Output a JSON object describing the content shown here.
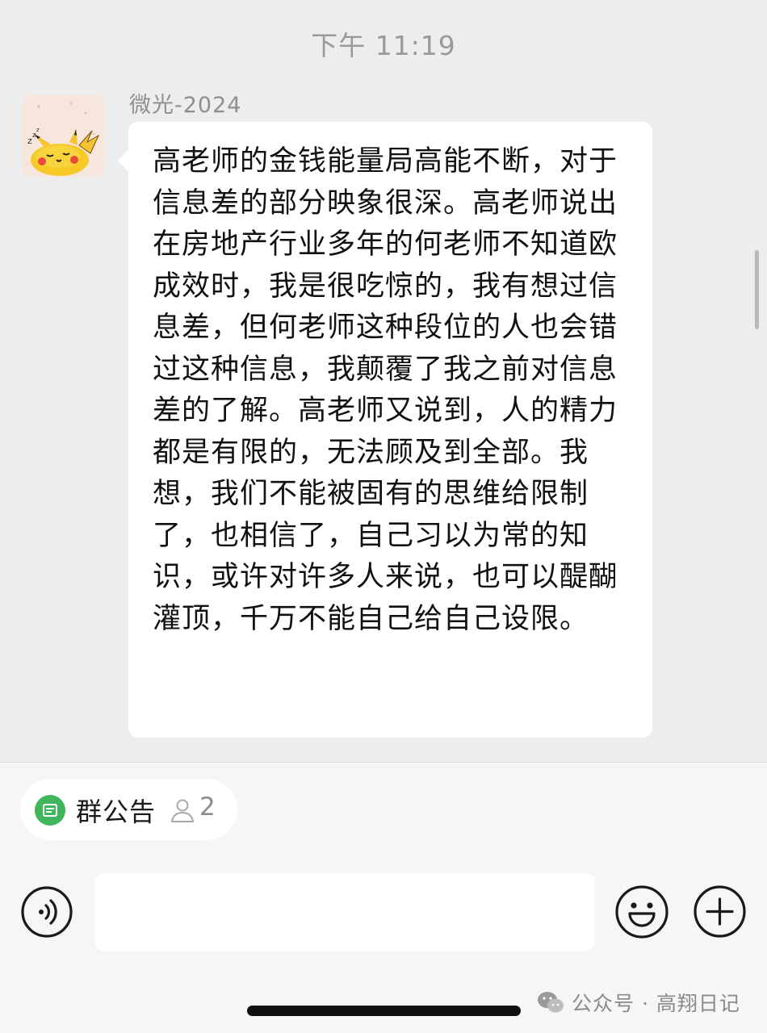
{
  "status": {
    "timestamp": "下午 11:19"
  },
  "message": {
    "sender": "微光-2024",
    "avatar_icon": "sleeping-pikachu-avatar",
    "text": "高老师的金钱能量局高能不断，对于信息差的部分映象很深。高老师说出在房地产行业多年的何老师不知道欧成效时，我是很吃惊的，我有想过信息差，但何老师这种段位的人也会错过这种信息，我颠覆了我之前对信息差的了解。高老师又说到，人的精力都是有限的，无法顾及到全部。我想，我们不能被固有的思维给限制了，也相信了，自己习以为常的知识，或许对许多人来说，也可以醍醐灌顶，千万不能自己给自己设限。"
  },
  "notice_bar": {
    "label": "群公告",
    "count": "2",
    "icon": "announcement-icon",
    "accent_color": "#3fb55c"
  },
  "input_bar": {
    "voice_icon": "voice-icon",
    "text_value": "",
    "emoji_icon": "emoji-icon",
    "plus_icon": "plus-icon"
  },
  "watermark": {
    "text": "公众号 · 高翔日记",
    "icon": "wechat-icon"
  }
}
